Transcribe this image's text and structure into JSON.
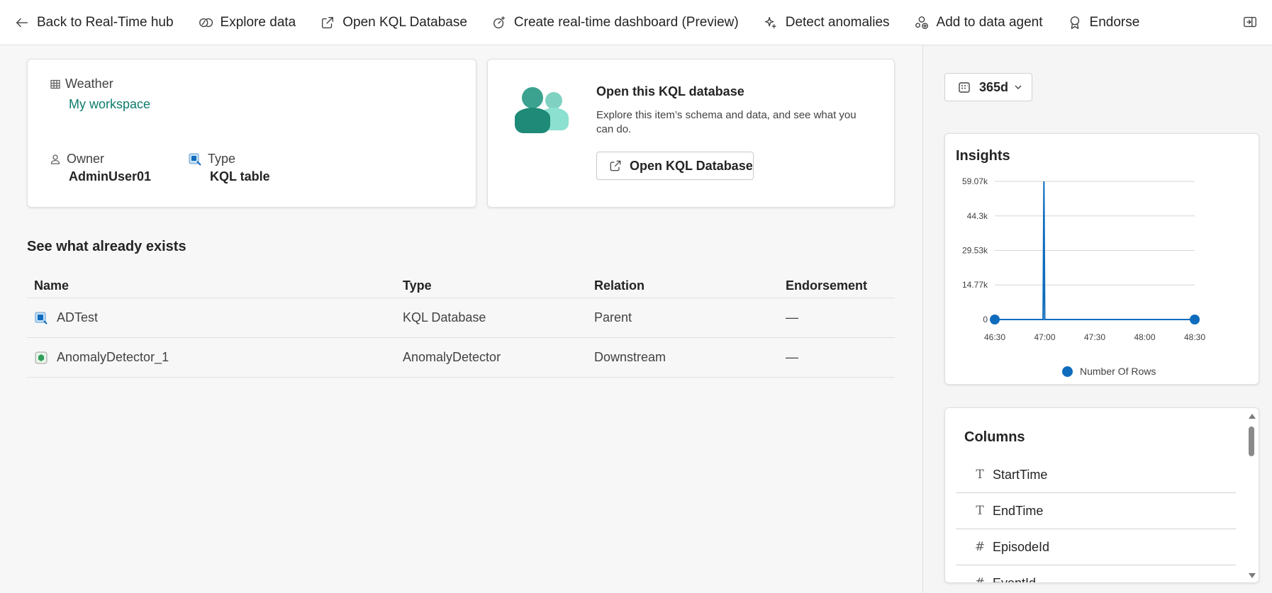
{
  "toolbar": {
    "items": [
      {
        "label": "Back to Real-Time hub",
        "icon": "arrow-left-icon"
      },
      {
        "label": "Explore data",
        "icon": "explore-icon"
      },
      {
        "label": "Open KQL Database",
        "icon": "open-external-icon"
      },
      {
        "label": "Create real-time dashboard (Preview)",
        "icon": "dashboard-sparkle-icon"
      },
      {
        "label": "Detect anomalies",
        "icon": "sparkle-icon"
      },
      {
        "label": "Add to data agent",
        "icon": "agent-add-icon"
      },
      {
        "label": "Endorse",
        "icon": "ribbon-icon"
      }
    ],
    "collapse_icon": "panel-collapse-icon"
  },
  "info": {
    "table_name": "Weather",
    "workspace": "My workspace",
    "owner_label": "Owner",
    "owner_value": "AdminUser01",
    "type_label": "Type",
    "type_value": "KQL table"
  },
  "open_card": {
    "title": "Open this KQL database",
    "description": "Explore this item’s schema and data, and see what you can do.",
    "button_label": "Open KQL Database"
  },
  "existing": {
    "title": "See what already exists",
    "headers": [
      "Name",
      "Type",
      "Relation",
      "Endorsement"
    ],
    "rows": [
      {
        "name": "ADTest",
        "type": "KQL Database",
        "relation": "Parent",
        "endorsement": "—"
      },
      {
        "name": "AnomalyDetector_1",
        "type": "AnomalyDetector",
        "relation": "Downstream",
        "endorsement": "—"
      }
    ]
  },
  "range": {
    "value": "365d"
  },
  "insights": {
    "title": "Insights",
    "legend": "Number Of Rows"
  },
  "chart_data": {
    "type": "line",
    "title": "Insights",
    "x_ticks": [
      "46:30",
      "47:00",
      "47:30",
      "48:00",
      "48:30"
    ],
    "y_ticks": [
      "0",
      "14.77k",
      "29.53k",
      "44.3k",
      "59.07k"
    ],
    "ylim": [
      0,
      59070
    ],
    "series": [
      {
        "name": "Number Of Rows",
        "color": "#0f6cbd",
        "points": [
          {
            "x": "46:30",
            "y": 0
          },
          {
            "x": "46:59",
            "y": 0
          },
          {
            "x": "46:59.5",
            "y": 59070
          },
          {
            "x": "47:00",
            "y": 0
          },
          {
            "x": "48:30",
            "y": 0
          }
        ]
      }
    ],
    "legend_position": "bottom",
    "grid": true
  },
  "columns": {
    "title": "Columns",
    "items": [
      {
        "name": "StartTime",
        "type_glyph": "T"
      },
      {
        "name": "EndTime",
        "type_glyph": "T"
      },
      {
        "name": "EpisodeId",
        "type_glyph": "#"
      },
      {
        "name": "EventId",
        "type_glyph": "#"
      }
    ]
  }
}
